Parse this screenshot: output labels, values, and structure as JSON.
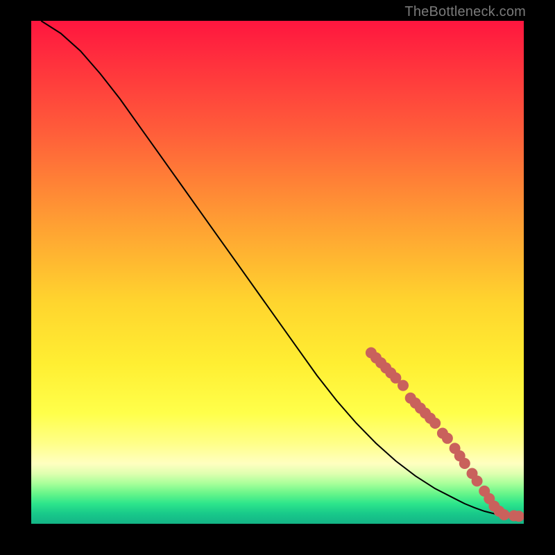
{
  "watermark": "TheBottleneck.com",
  "colors": {
    "curve": "#000000",
    "marker_fill": "#c9615c",
    "marker_stroke": "#b9524f",
    "background_black": "#000000"
  },
  "chart_data": {
    "type": "line",
    "title": "",
    "xlabel": "",
    "ylabel": "",
    "xlim": [
      0,
      100
    ],
    "ylim": [
      0,
      100
    ],
    "grid": false,
    "series": [
      {
        "name": "curve",
        "x": [
          2,
          6,
          10,
          14,
          18,
          22,
          26,
          30,
          34,
          38,
          42,
          46,
          50,
          54,
          58,
          62,
          66,
          70,
          74,
          78,
          82,
          86,
          88,
          90,
          92,
          94,
          96,
          98,
          100
        ],
        "y": [
          100,
          97.5,
          94.0,
          89.5,
          84.5,
          79.0,
          73.5,
          68.0,
          62.5,
          57.0,
          51.5,
          46.0,
          40.5,
          35.0,
          29.5,
          24.5,
          20.0,
          16.0,
          12.5,
          9.5,
          7.0,
          5.0,
          4.0,
          3.2,
          2.5,
          2.0,
          1.7,
          1.5,
          1.5
        ]
      }
    ],
    "markers": [
      {
        "x": 69,
        "y": 34.0
      },
      {
        "x": 70,
        "y": 33.0
      },
      {
        "x": 71,
        "y": 32.0
      },
      {
        "x": 72,
        "y": 31.0
      },
      {
        "x": 73,
        "y": 30.0
      },
      {
        "x": 74,
        "y": 29.0
      },
      {
        "x": 75.5,
        "y": 27.5
      },
      {
        "x": 77,
        "y": 25.0
      },
      {
        "x": 78,
        "y": 24.0
      },
      {
        "x": 79,
        "y": 23.0
      },
      {
        "x": 80,
        "y": 22.0
      },
      {
        "x": 81,
        "y": 21.0
      },
      {
        "x": 82,
        "y": 20.0
      },
      {
        "x": 83.5,
        "y": 18.0
      },
      {
        "x": 84.5,
        "y": 17.0
      },
      {
        "x": 86,
        "y": 15.0
      },
      {
        "x": 87,
        "y": 13.5
      },
      {
        "x": 88,
        "y": 12.0
      },
      {
        "x": 89.5,
        "y": 10.0
      },
      {
        "x": 90.5,
        "y": 8.5
      },
      {
        "x": 92,
        "y": 6.5
      },
      {
        "x": 93,
        "y": 5.0
      },
      {
        "x": 94,
        "y": 3.5
      },
      {
        "x": 95,
        "y": 2.5
      },
      {
        "x": 96,
        "y": 1.8
      },
      {
        "x": 98,
        "y": 1.6
      },
      {
        "x": 99,
        "y": 1.5
      },
      {
        "x": 101,
        "y": 1.5
      },
      {
        "x": 102,
        "y": 1.5
      },
      {
        "x": 105,
        "y": 1.5
      }
    ]
  }
}
